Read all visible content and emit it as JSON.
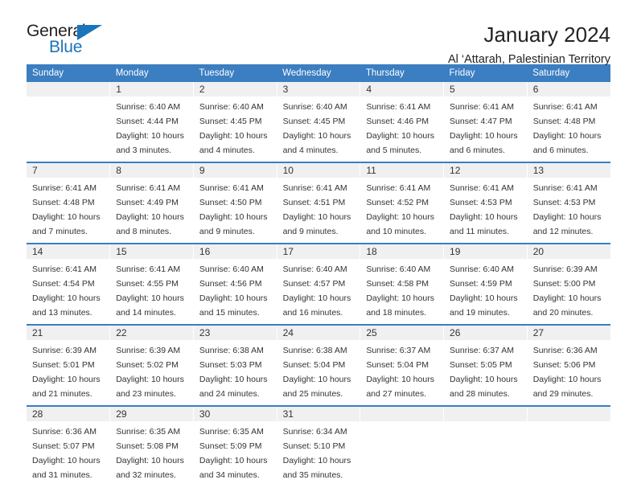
{
  "brand": {
    "name_top": "General",
    "name_bottom": "Blue",
    "accent_color": "#1b75bb"
  },
  "header": {
    "title": "January 2024",
    "subtitle": "Al ‘Attarah, Palestinian Territory"
  },
  "theme": {
    "header_blue": "#3b7ec1",
    "daynum_bg": "#f0f0f0",
    "cell_bg": "#ffffff",
    "text": "#333333"
  },
  "calendar": {
    "weekday_headers": [
      "Sunday",
      "Monday",
      "Tuesday",
      "Wednesday",
      "Thursday",
      "Friday",
      "Saturday"
    ],
    "weeks": [
      {
        "days": [
          {
            "num": "",
            "text": ""
          },
          {
            "num": "1",
            "text": "Sunrise: 6:40 AM\nSunset: 4:44 PM\nDaylight: 10 hours\nand 3 minutes."
          },
          {
            "num": "2",
            "text": "Sunrise: 6:40 AM\nSunset: 4:45 PM\nDaylight: 10 hours\nand 4 minutes."
          },
          {
            "num": "3",
            "text": "Sunrise: 6:40 AM\nSunset: 4:45 PM\nDaylight: 10 hours\nand 4 minutes."
          },
          {
            "num": "4",
            "text": "Sunrise: 6:41 AM\nSunset: 4:46 PM\nDaylight: 10 hours\nand 5 minutes."
          },
          {
            "num": "5",
            "text": "Sunrise: 6:41 AM\nSunset: 4:47 PM\nDaylight: 10 hours\nand 6 minutes."
          },
          {
            "num": "6",
            "text": "Sunrise: 6:41 AM\nSunset: 4:48 PM\nDaylight: 10 hours\nand 6 minutes."
          }
        ]
      },
      {
        "days": [
          {
            "num": "7",
            "text": "Sunrise: 6:41 AM\nSunset: 4:48 PM\nDaylight: 10 hours\nand 7 minutes."
          },
          {
            "num": "8",
            "text": "Sunrise: 6:41 AM\nSunset: 4:49 PM\nDaylight: 10 hours\nand 8 minutes."
          },
          {
            "num": "9",
            "text": "Sunrise: 6:41 AM\nSunset: 4:50 PM\nDaylight: 10 hours\nand 9 minutes."
          },
          {
            "num": "10",
            "text": "Sunrise: 6:41 AM\nSunset: 4:51 PM\nDaylight: 10 hours\nand 9 minutes."
          },
          {
            "num": "11",
            "text": "Sunrise: 6:41 AM\nSunset: 4:52 PM\nDaylight: 10 hours\nand 10 minutes."
          },
          {
            "num": "12",
            "text": "Sunrise: 6:41 AM\nSunset: 4:53 PM\nDaylight: 10 hours\nand 11 minutes."
          },
          {
            "num": "13",
            "text": "Sunrise: 6:41 AM\nSunset: 4:53 PM\nDaylight: 10 hours\nand 12 minutes."
          }
        ]
      },
      {
        "days": [
          {
            "num": "14",
            "text": "Sunrise: 6:41 AM\nSunset: 4:54 PM\nDaylight: 10 hours\nand 13 minutes."
          },
          {
            "num": "15",
            "text": "Sunrise: 6:41 AM\nSunset: 4:55 PM\nDaylight: 10 hours\nand 14 minutes."
          },
          {
            "num": "16",
            "text": "Sunrise: 6:40 AM\nSunset: 4:56 PM\nDaylight: 10 hours\nand 15 minutes."
          },
          {
            "num": "17",
            "text": "Sunrise: 6:40 AM\nSunset: 4:57 PM\nDaylight: 10 hours\nand 16 minutes."
          },
          {
            "num": "18",
            "text": "Sunrise: 6:40 AM\nSunset: 4:58 PM\nDaylight: 10 hours\nand 18 minutes."
          },
          {
            "num": "19",
            "text": "Sunrise: 6:40 AM\nSunset: 4:59 PM\nDaylight: 10 hours\nand 19 minutes."
          },
          {
            "num": "20",
            "text": "Sunrise: 6:39 AM\nSunset: 5:00 PM\nDaylight: 10 hours\nand 20 minutes."
          }
        ]
      },
      {
        "days": [
          {
            "num": "21",
            "text": "Sunrise: 6:39 AM\nSunset: 5:01 PM\nDaylight: 10 hours\nand 21 minutes."
          },
          {
            "num": "22",
            "text": "Sunrise: 6:39 AM\nSunset: 5:02 PM\nDaylight: 10 hours\nand 23 minutes."
          },
          {
            "num": "23",
            "text": "Sunrise: 6:38 AM\nSunset: 5:03 PM\nDaylight: 10 hours\nand 24 minutes."
          },
          {
            "num": "24",
            "text": "Sunrise: 6:38 AM\nSunset: 5:04 PM\nDaylight: 10 hours\nand 25 minutes."
          },
          {
            "num": "25",
            "text": "Sunrise: 6:37 AM\nSunset: 5:04 PM\nDaylight: 10 hours\nand 27 minutes."
          },
          {
            "num": "26",
            "text": "Sunrise: 6:37 AM\nSunset: 5:05 PM\nDaylight: 10 hours\nand 28 minutes."
          },
          {
            "num": "27",
            "text": "Sunrise: 6:36 AM\nSunset: 5:06 PM\nDaylight: 10 hours\nand 29 minutes."
          }
        ]
      },
      {
        "days": [
          {
            "num": "28",
            "text": "Sunrise: 6:36 AM\nSunset: 5:07 PM\nDaylight: 10 hours\nand 31 minutes."
          },
          {
            "num": "29",
            "text": "Sunrise: 6:35 AM\nSunset: 5:08 PM\nDaylight: 10 hours\nand 32 minutes."
          },
          {
            "num": "30",
            "text": "Sunrise: 6:35 AM\nSunset: 5:09 PM\nDaylight: 10 hours\nand 34 minutes."
          },
          {
            "num": "31",
            "text": "Sunrise: 6:34 AM\nSunset: 5:10 PM\nDaylight: 10 hours\nand 35 minutes."
          },
          {
            "num": "",
            "text": ""
          },
          {
            "num": "",
            "text": ""
          },
          {
            "num": "",
            "text": ""
          }
        ]
      }
    ]
  }
}
